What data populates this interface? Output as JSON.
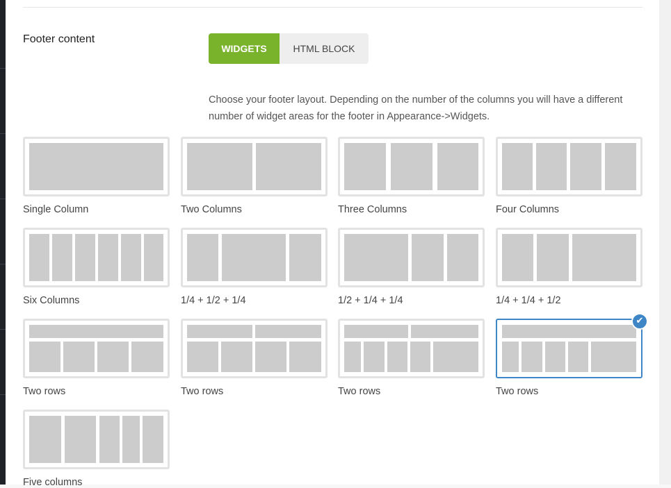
{
  "section": {
    "label": "Footer content"
  },
  "toggle": {
    "widgets": "WIDGETS",
    "html_block": "HTML BLOCK",
    "selected": "WIDGETS"
  },
  "description": "Choose your footer layout. Depending on the number of the columns you will have a different number of widget areas for the footer in Appearance->Widgets.",
  "layouts": [
    {
      "label": "Single Column"
    },
    {
      "label": "Two Columns"
    },
    {
      "label": "Three Columns"
    },
    {
      "label": "Four Columns"
    },
    {
      "label": "Six Columns"
    },
    {
      "label": "1/4 + 1/2 + 1/4"
    },
    {
      "label": "1/2 + 1/4 + 1/4"
    },
    {
      "label": "1/4 + 1/4 + 1/2"
    },
    {
      "label": "Two rows"
    },
    {
      "label": "Two rows"
    },
    {
      "label": "Two rows"
    },
    {
      "label": "Two rows",
      "selected": true
    },
    {
      "label": "Five columns"
    }
  ],
  "colors": {
    "accent": "#79b22b",
    "selected_border": "#3f86c6",
    "placeholder": "#cccccc"
  }
}
